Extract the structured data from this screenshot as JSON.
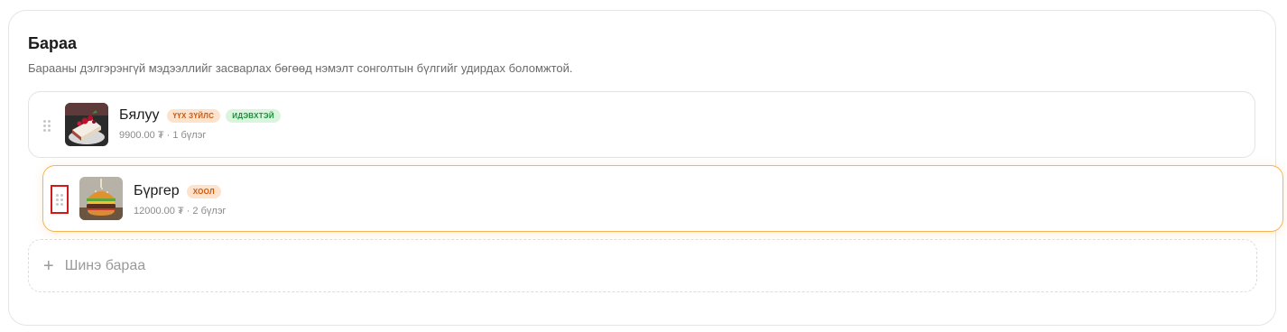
{
  "section": {
    "title": "Бараа",
    "description": "Барааны дэлгэрэнгүй мэдээллийг засварлах бөгөөд нэмэлт сонголтын бүлгийг удирдах боломжтой."
  },
  "products": [
    {
      "name": "Бялуу",
      "badges": [
        {
          "label": "ҮҮХ ЗҮЙЛС",
          "color": "orange"
        },
        {
          "label": "ИДЭВХТЭЙ",
          "color": "green"
        }
      ],
      "meta": "9900.00 ₮ · 1 бүлэг",
      "image_icon": "cake-thumbnail"
    },
    {
      "name": "Бүргер",
      "badges": [
        {
          "label": "ХООЛ",
          "color": "orange"
        }
      ],
      "meta": "12000.00 ₮ · 2 бүлэг",
      "image_icon": "burger-thumbnail"
    }
  ],
  "add_item": {
    "label": "Шинэ бараа",
    "icon": "plus-icon"
  },
  "colors": {
    "accent_border": "#f6b452",
    "highlight_box": "#d11a1a",
    "badge_orange_bg": "#fde2cc",
    "badge_orange_text": "#c75a12",
    "badge_green_bg": "#d9f5de",
    "badge_green_text": "#1d8a3a"
  }
}
